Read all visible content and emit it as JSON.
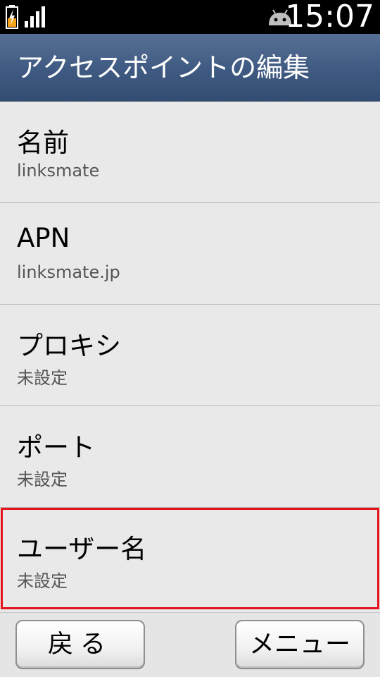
{
  "status_bar": {
    "time": "15:07",
    "icons": [
      "battery-charging-icon",
      "signal-icon",
      "android-icon"
    ]
  },
  "header": {
    "title": "アクセスポイントの編集"
  },
  "settings": [
    {
      "label": "名前",
      "value": "linksmate"
    },
    {
      "label": "APN",
      "value": "linksmate.jp"
    },
    {
      "label": "プロキシ",
      "value": "未設定"
    },
    {
      "label": "ポート",
      "value": "未設定"
    },
    {
      "label": "ユーザー名",
      "value": "未設定"
    }
  ],
  "buttons": {
    "back": "戻る",
    "menu": "メニュー"
  },
  "colors": {
    "header": "#3f5a82",
    "highlight": "#e5141c",
    "battery": "#f5a21b"
  }
}
